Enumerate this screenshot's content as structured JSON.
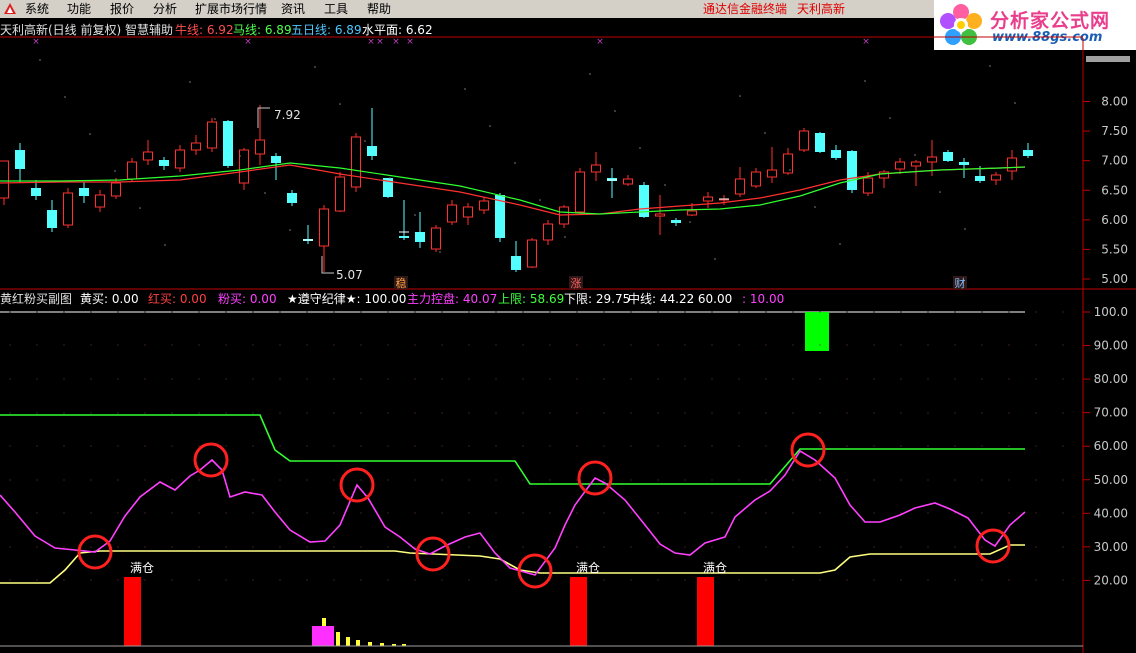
{
  "menubar": {
    "items": [
      "系统",
      "功能",
      "报价",
      "分析",
      "扩展市场行情",
      "资讯",
      "工具",
      "帮助"
    ],
    "terminal_title": "通达信金融终端",
    "stock_name": "天利高新"
  },
  "brand": {
    "title": "分析家公式网",
    "url": "www.88gs.com"
  },
  "price_panel": {
    "title": "天利高新(日线 前复权) 智慧辅助",
    "indicators": [
      {
        "label": "牛线:",
        "value": "6.92",
        "color": "#ff5050"
      },
      {
        "label": "马线:",
        "value": "6.89",
        "color": "#50ff50"
      },
      {
        "label": "五日线:",
        "value": "6.89",
        "color": "#50c8ff"
      },
      {
        "label": "水平面:",
        "value": "6.62",
        "color": "#ffffff"
      }
    ],
    "y_ticks": [
      "8.00",
      "7.50",
      "7.00",
      "6.50",
      "6.00",
      "5.50",
      "5.00"
    ],
    "high_label": "7.92",
    "low_label": "5.07",
    "markers": [
      {
        "text": "稳",
        "color": "#ffa040"
      },
      {
        "text": "涨",
        "color": "#ff6060"
      },
      {
        "text": "财",
        "color": "#80c0ff"
      }
    ]
  },
  "sub_panel": {
    "indicators": [
      {
        "label": "黄红粉买副图",
        "value": "",
        "color": "#e0e0e0"
      },
      {
        "label": "黄买:",
        "value": "0.00",
        "color": "#ffffff"
      },
      {
        "label": "红买:",
        "value": "0.00",
        "color": "#ff4040"
      },
      {
        "label": "粉买:",
        "value": "0.00",
        "color": "#ff40ff"
      },
      {
        "label": "★遵守纪律★:",
        "value": "100.00",
        "color": "#ffffff"
      },
      {
        "label": "主力控盘:",
        "value": "40.07",
        "color": "#ff40ff"
      },
      {
        "label": "上限:",
        "value": "58.69",
        "color": "#40ff40"
      },
      {
        "label": "下限:",
        "value": "29.75",
        "color": "#ffffff"
      },
      {
        "label": "中线:",
        "value": "44.22",
        "color": "#ffffff"
      },
      {
        "label": ":",
        "value": "60.00",
        "color": "#ffffff"
      },
      {
        "label": ":",
        "value": "10.00",
        "color": "#ff40ff"
      }
    ],
    "y_ticks": [
      "100.0",
      "90.00",
      "80.00",
      "70.00",
      "60.00",
      "50.00",
      "40.00",
      "30.00",
      "20.00"
    ],
    "full_position_label": "满仓"
  },
  "colors": {
    "up": "#ff3030",
    "down": "#54ffff",
    "ma_red": "#ff3030",
    "ma_green": "#30ff30",
    "upper": "#30ff30",
    "lower": "#ffff80",
    "control": "#ff40ff",
    "grid_axis": "#c00000"
  }
}
